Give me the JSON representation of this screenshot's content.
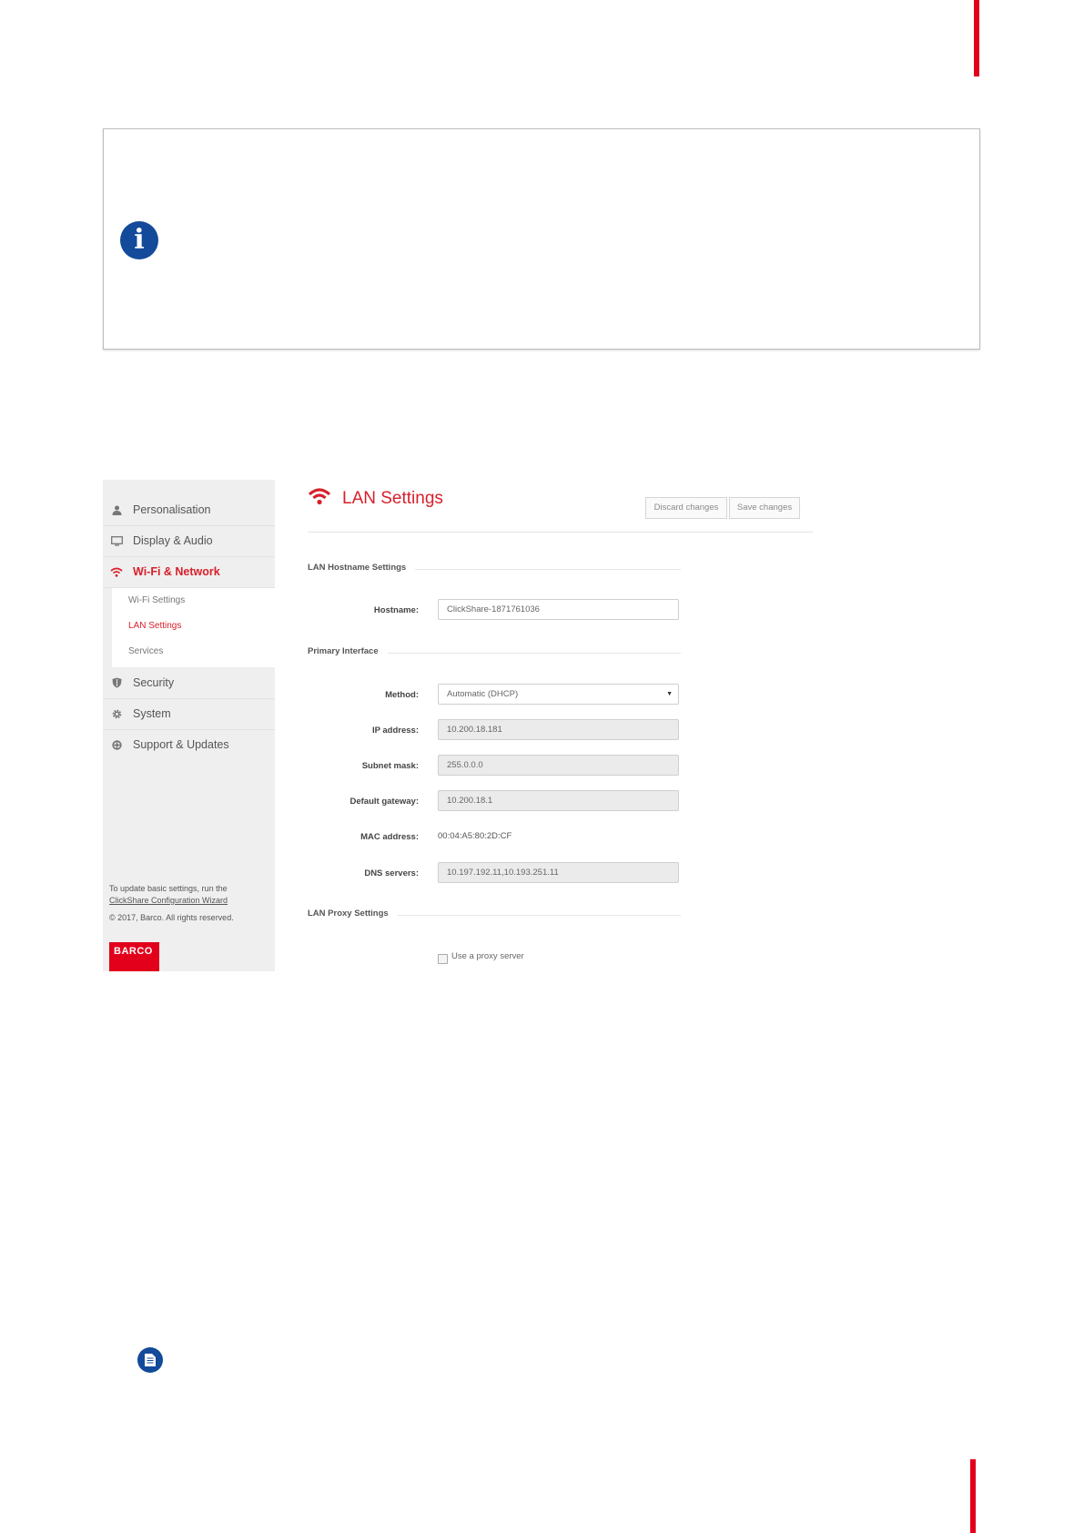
{
  "colors": {
    "accent": "#d7202b",
    "brand_red": "#e2001a",
    "info_blue": "#134a9a"
  },
  "info_box": {
    "icon": "info-icon"
  },
  "note": {
    "icon": "document-icon"
  },
  "sidebar": {
    "items": [
      {
        "label": "Personalisation",
        "icon": "user-icon"
      },
      {
        "label": "Display & Audio",
        "icon": "monitor-icon"
      },
      {
        "label": "Wi-Fi & Network",
        "icon": "wifi-icon",
        "active": true
      },
      {
        "label": "Security",
        "icon": "shield-icon"
      },
      {
        "label": "System",
        "icon": "gear-icon"
      },
      {
        "label": "Support & Updates",
        "icon": "lifebuoy-icon"
      }
    ],
    "subitems": [
      {
        "label": "Wi-Fi Settings"
      },
      {
        "label": "LAN Settings",
        "active": true
      },
      {
        "label": "Services"
      }
    ],
    "footer_text": "To update basic settings, run the",
    "footer_link": "ClickShare Configuration Wizard",
    "copyright": "© 2017, Barco. All rights reserved.",
    "logo_text": "BARCO"
  },
  "main": {
    "title": "LAN Settings",
    "discard_label": "Discard changes",
    "save_label": "Save changes",
    "hostname_section": "LAN Hostname Settings",
    "hostname_label": "Hostname:",
    "hostname_value": "ClickShare-1871761036",
    "primary_section": "Primary Interface",
    "method_label": "Method:",
    "method_value": "Automatic (DHCP)",
    "ip_label": "IP address:",
    "ip_value": "10.200.18.181",
    "subnet_label": "Subnet mask:",
    "subnet_value": "255.0.0.0",
    "gateway_label": "Default gateway:",
    "gateway_value": "10.200.18.1",
    "mac_label": "MAC address:",
    "mac_value": "00:04:A5:80:2D:CF",
    "dns_label": "DNS servers:",
    "dns_value": "10.197.192.11,10.193.251.11",
    "proxy_section": "LAN Proxy Settings",
    "proxy_checkbox_label": "Use a proxy server"
  }
}
